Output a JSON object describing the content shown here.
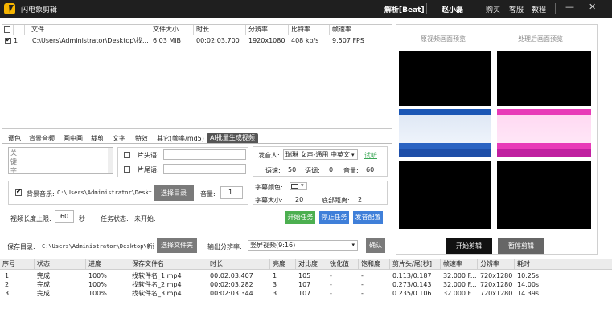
{
  "titlebar": {
    "app_title": "闪电象剪辑",
    "analyze": "解析[Beat]",
    "user": "赵小磊",
    "menu": [
      "购买",
      "客服",
      "教程"
    ],
    "min_glyph": "—",
    "close_glyph": "✕"
  },
  "file_table": {
    "headers": [
      "文件",
      "文件大小",
      "时长",
      "分辨率",
      "比特率",
      "帧速率"
    ],
    "rows": [
      {
        "index": "1",
        "path": "C:\\Users\\Administrator\\Desktop\\找...",
        "size": "6.03 MiB",
        "duration": "00:02:03.700",
        "resolution": "1920x1080",
        "bitrate": "408 kb/s",
        "fps": "9.507 FPS",
        "checked": true
      }
    ]
  },
  "tabs": [
    "调色",
    "背景音频",
    "画中画",
    "裁剪",
    "文字",
    "特效",
    "其它(帧率/md5)",
    "AI批量生成视频"
  ],
  "ai_panel": {
    "keyword_label": "关\n键\n字",
    "opening_label": "片头语:",
    "ending_label": "片尾语:",
    "voice_label": "发音人:",
    "voice_value": "瑞琳 女声-通用 中英文",
    "listen_link": "试听",
    "speed_label": "语速:",
    "speed_value": "50",
    "tone_label": "语调:",
    "tone_value": "0",
    "volume_label": "音量:",
    "volume_value": "60",
    "bgm_label": "背景音乐:",
    "bgm_path": "C:\\Users\\Administrator\\Deskto",
    "choose_dir_button": "选择目录",
    "bgm_volume_label": "音量:",
    "bgm_volume_value": "1",
    "subtitle_color_label": "字幕颜色:",
    "subtitle_size_label": "字幕大小:",
    "subtitle_size_value": "20",
    "bottom_distance_label": "底部距离:",
    "bottom_distance_value": "2",
    "max_length_label": "视频长度上限:",
    "max_length_value": "60",
    "max_length_unit": "秒",
    "task_status_label": "任务状态:",
    "task_status_value": "未开始.",
    "start_task_button": "开始任务",
    "stop_task_button": "停止任务",
    "voice_config_button": "发音配置"
  },
  "preview": {
    "original_title": "原视频画面预览",
    "processed_title": "处理后画面预览"
  },
  "output": {
    "save_dir_label": "保存目录:",
    "save_dir_value": "C:\\Users\\Administrator\\Desktop\\新建",
    "choose_folder_button": "选择文件夹",
    "resolution_label": "输出分辨率:",
    "resolution_value": "竖屏视频(9:16)",
    "confirm_button": "确认",
    "start_edit_button": "开始剪辑",
    "pause_edit_button": "暂停剪辑"
  },
  "task_table": {
    "headers": [
      "序号",
      "状态",
      "进度",
      "保存文件名",
      "时长",
      "亮度",
      "对比度",
      "锐化值",
      "饱和度",
      "剪片头/尾[秒]",
      "帧速率",
      "分辨率",
      "耗时"
    ],
    "rows": [
      [
        "1",
        "完成",
        "100%",
        "找软件名_1.mp4",
        "00:02:03.407",
        "1",
        "105",
        "-",
        "-",
        "0.113/0.187",
        "32.000 F...",
        "720x1280",
        "10.25s"
      ],
      [
        "2",
        "完成",
        "100%",
        "找软件名_2.mp4",
        "00:02:03.282",
        "3",
        "107",
        "-",
        "-",
        "0.273/0.143",
        "32.000 F...",
        "720x1280",
        "14.00s"
      ],
      [
        "3",
        "完成",
        "100%",
        "找软件名_3.mp4",
        "00:02:03.344",
        "3",
        "107",
        "-",
        "-",
        "0.235/0.106",
        "32.000 F...",
        "720x1280",
        "14.39s"
      ]
    ]
  }
}
